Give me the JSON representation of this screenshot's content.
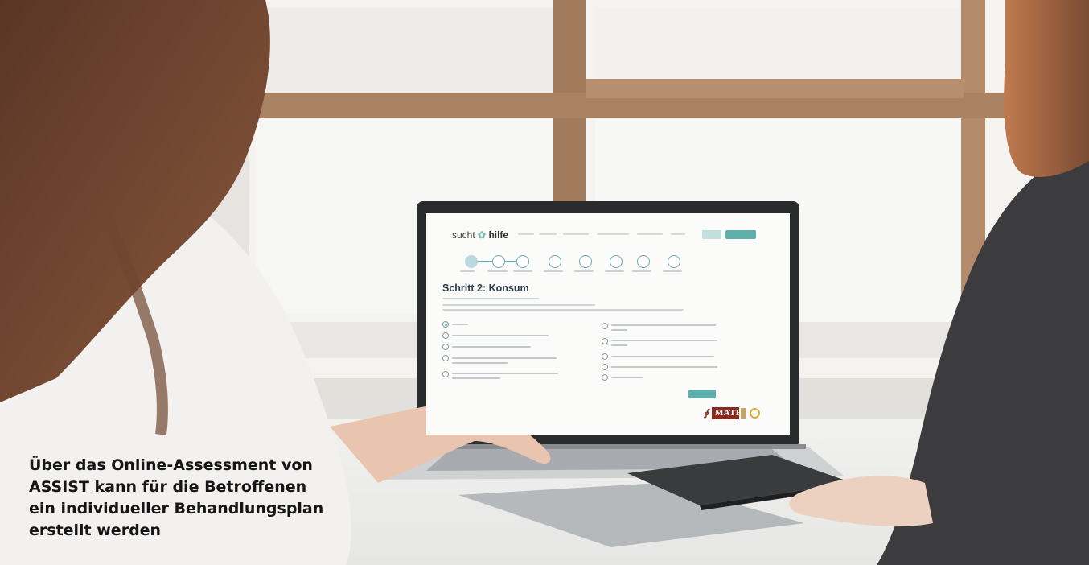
{
  "caption": {
    "line1": "Über das Online-Assessment von",
    "line2": "ASSIST kann für die Betroffenen",
    "line3": "ein individueller Behandlungsplan",
    "line4": "erstellt werden"
  },
  "screen": {
    "logo_left": "sucht",
    "logo_right": "hilfe",
    "title": "Schritt 2: Konsum",
    "brand_badge": "MATE",
    "selected_option_index": 0
  },
  "colors": {
    "accent": "#5fb0aa",
    "brand": "#8a2b1f",
    "heading": "#2c3b46"
  }
}
